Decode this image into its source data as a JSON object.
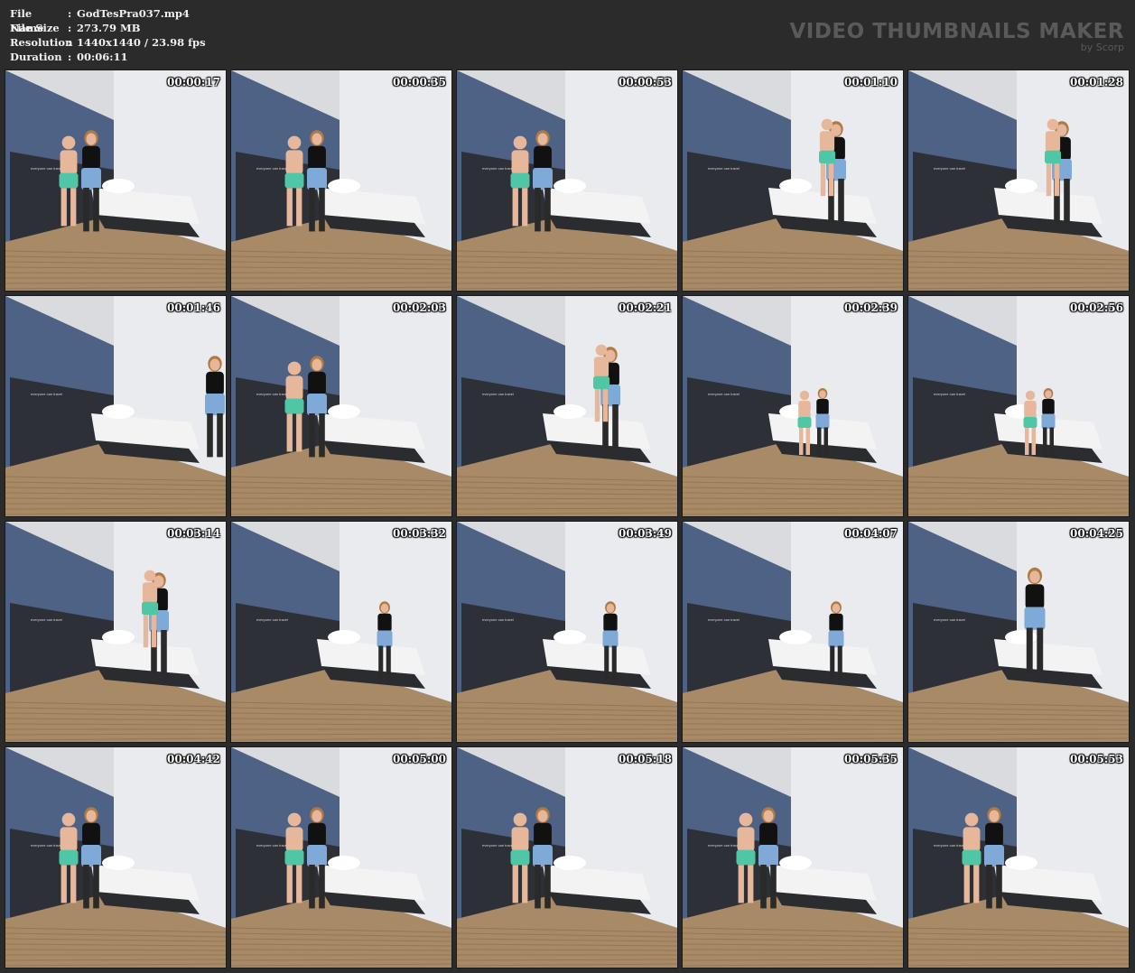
{
  "info": {
    "rows": [
      {
        "key": "File Name",
        "value": "GodTesPra037.mp4"
      },
      {
        "key": "File Size",
        "value": "273.79 MB"
      },
      {
        "key": "Resolution",
        "value": "1440x1440 / 23.98 fps"
      },
      {
        "key": "Duration",
        "value": "00:06:11"
      }
    ],
    "separator": ":"
  },
  "brand": {
    "title": "VIDEO THUMBNAILS MAKER",
    "subtitle": "by Scorp"
  },
  "wall_text": "everyone can travel",
  "thumbnails": [
    {
      "time": "00:00:17",
      "scene": "standing-pair"
    },
    {
      "time": "00:00:35",
      "scene": "standing-pair"
    },
    {
      "time": "00:00:53",
      "scene": "standing-pair"
    },
    {
      "time": "00:01:10",
      "scene": "lift"
    },
    {
      "time": "00:01:28",
      "scene": "lift"
    },
    {
      "time": "00:01:46",
      "scene": "carry-edge"
    },
    {
      "time": "00:02:03",
      "scene": "standing-pair"
    },
    {
      "time": "00:02:21",
      "scene": "lift"
    },
    {
      "time": "00:02:39",
      "scene": "seated"
    },
    {
      "time": "00:02:56",
      "scene": "seated"
    },
    {
      "time": "00:03:14",
      "scene": "lift"
    },
    {
      "time": "00:03:32",
      "scene": "bed"
    },
    {
      "time": "00:03:49",
      "scene": "bed"
    },
    {
      "time": "00:04:07",
      "scene": "bed"
    },
    {
      "time": "00:04:25",
      "scene": "bed-standing"
    },
    {
      "time": "00:04:42",
      "scene": "standing-pair"
    },
    {
      "time": "00:05:00",
      "scene": "standing-pair"
    },
    {
      "time": "00:05:18",
      "scene": "standing-pair"
    },
    {
      "time": "00:05:35",
      "scene": "standing-pair"
    },
    {
      "time": "00:05:53",
      "scene": "standing-pair"
    }
  ]
}
